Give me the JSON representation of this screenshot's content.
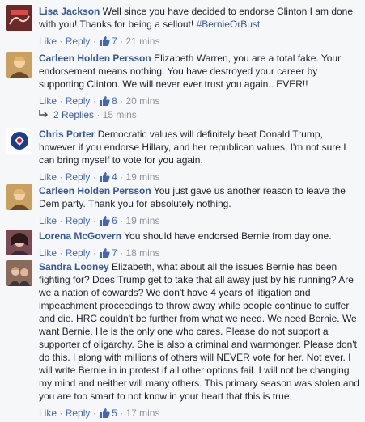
{
  "actions": {
    "like": "Like",
    "reply": "Reply",
    "dot": "·"
  },
  "comments": [
    {
      "name": "Lisa Jackson",
      "text": "Well since you have decided to endorse Clinton I am done with you! Thanks for being a sellout! ",
      "hashtag": "#BernieOrBust",
      "likes": "7",
      "time": "21 mins",
      "avatar_color": "#6b2a2a"
    },
    {
      "name": "Carleen Holden Persson",
      "text": "Elizabeth Warren, you are a total fake. Your endorsement means nothing. You have destroyed your career by supporting Clinton. We will never ever trust you again.. EVER!!",
      "likes": "8",
      "time": "20 mins",
      "avatar_color": "#a8763a"
    },
    {
      "name": "Chris Porter",
      "text": "Democratic values will definitely beat Donald Trump, however if you endorse Hillary, and her republican values, I'm not sure I can bring myself to vote for you again.",
      "likes": "4",
      "time": "19 mins",
      "avatar_color": "#1b3d8c"
    },
    {
      "name": "Carleen Holden Persson",
      "text": "You just gave us another reason to leave the Dem party. Thank you for absolutely nothing.",
      "likes": "6",
      "time": "19 mins",
      "avatar_color": "#a8763a"
    },
    {
      "name": "Lorena McGovern",
      "text": "You should have endorsed Bernie from day one.",
      "likes": "7",
      "time": "18 mins",
      "avatar_color": "#7a4a52"
    },
    {
      "name": "Sandra Looney",
      "text": "Elizabeth, what about all the issues Bernie has been fighting for? Does Trump get to take that all away just by his running? Are we a nation of cowards? We don't have 4 years of litigation and impeachment proceedings to throw away while people continue to suffer and die. HRC couldn't be further from what we need. We need Bernie. We want Bernie. He is the only one who cares. Please do not support a supporter of oligarchy. She is also a criminal and warmonger. Please don't do this. I along with millions of others will NEVER vote for her. Not ever. I will write Bernie in in protest if all other options fail. I will not be changing my mind and neither will many others. This primary season was stolen and you are too smart to not know in your heart that this is true.",
      "likes": "5",
      "time": "17 mins",
      "avatar_color": "#8a6a5a"
    }
  ],
  "replies_link": {
    "label": "2 Replies",
    "time": "15 mins"
  }
}
